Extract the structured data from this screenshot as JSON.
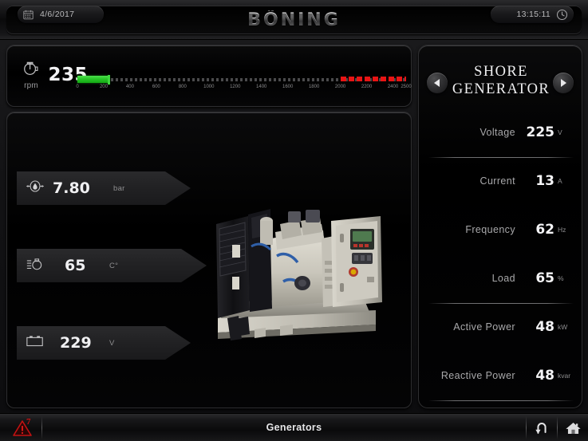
{
  "header": {
    "date": "4/6/2017",
    "time": "13:15:11",
    "brand": "BÖNING",
    "calendar_icon": "calendar-icon",
    "clock_icon": "clock-icon"
  },
  "rpm": {
    "icon": "engine-rpm-icon",
    "unit_label": "rpm",
    "value": "235",
    "value_num": 235,
    "scale_min": 0,
    "scale_max": 2500,
    "redline_start": 2000,
    "ticks": [
      "0",
      "200",
      "400",
      "600",
      "800",
      "1000",
      "1200",
      "1400",
      "1600",
      "1800",
      "2000",
      "2200",
      "2400",
      "2500"
    ],
    "tick_values": [
      0,
      200,
      400,
      600,
      800,
      1000,
      1200,
      1400,
      1600,
      1800,
      2000,
      2200,
      2400,
      2500
    ],
    "fill_color": "#25c425",
    "red_color": "#e81414"
  },
  "gauges": [
    {
      "icon": "oil-pressure-icon",
      "value": "7.80",
      "unit": "bar"
    },
    {
      "icon": "coolant-temperature-icon",
      "value": "65",
      "unit": "C°"
    },
    {
      "icon": "battery-voltage-icon",
      "value": "229",
      "unit": "V"
    }
  ],
  "genset_image": "diesel-generator-set-photo",
  "side": {
    "title_line1": "SHORE",
    "title_line2": "GENERATOR",
    "prev_icon": "chevron-left-icon",
    "next_icon": "chevron-right-icon",
    "rows": [
      {
        "label": "Voltage",
        "value": "225",
        "unit": "V"
      },
      {
        "label": "Current",
        "value": "13",
        "unit": "A"
      },
      {
        "label": "Frequency",
        "value": "62",
        "unit": "Hz"
      },
      {
        "label": "Load",
        "value": "65",
        "unit": "%"
      },
      {
        "label": "Active Power",
        "value": "48",
        "unit": "kW"
      },
      {
        "label": "Reactive Power",
        "value": "48",
        "unit": "kvar"
      }
    ]
  },
  "footer": {
    "alarm_icon": "alarm-warning-triangle-icon",
    "alarm_count": "7",
    "title": "Generators",
    "back_icon": "back-arrow-icon",
    "home_icon": "home-icon"
  }
}
